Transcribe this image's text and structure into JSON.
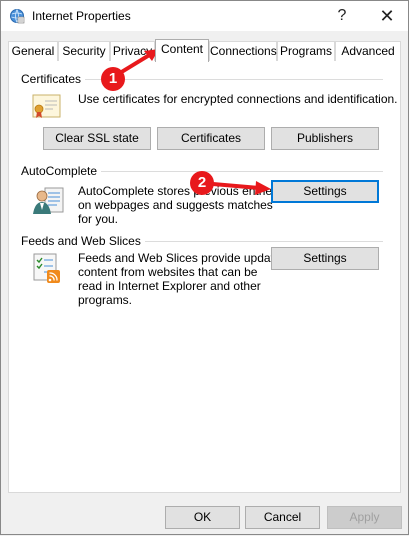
{
  "window": {
    "title": "Internet Properties",
    "help_glyph": "?",
    "close_glyph": "✕"
  },
  "tabs": [
    {
      "label": "General"
    },
    {
      "label": "Security"
    },
    {
      "label": "Privacy"
    },
    {
      "label": "Content",
      "active": true
    },
    {
      "label": "Connections"
    },
    {
      "label": "Programs"
    },
    {
      "label": "Advanced"
    }
  ],
  "certificates": {
    "title": "Certificates",
    "description": "Use certificates for encrypted connections and identification.",
    "buttons": {
      "clear_ssl": "Clear SSL state",
      "certificates": "Certificates",
      "publishers": "Publishers"
    }
  },
  "autocomplete": {
    "title": "AutoComplete",
    "description_lines": [
      "AutoComplete stores previous entries",
      "on webpages and suggests matches",
      "for you."
    ],
    "settings_label": "Settings"
  },
  "feeds": {
    "title": "Feeds and Web Slices",
    "description_lines": [
      "Feeds and Web Slices provide updated",
      "content from websites that can be",
      "read in Internet Explorer and other",
      "programs."
    ],
    "settings_label": "Settings"
  },
  "footer": {
    "ok": "OK",
    "cancel": "Cancel",
    "apply": "Apply"
  },
  "annotations": {
    "callout_1": "1",
    "callout_2": "2",
    "color": "#e8191c"
  },
  "icons": [
    "internet-options-icon",
    "certificate-icon",
    "autocomplete-user-icon",
    "feeds-rss-icon"
  ]
}
